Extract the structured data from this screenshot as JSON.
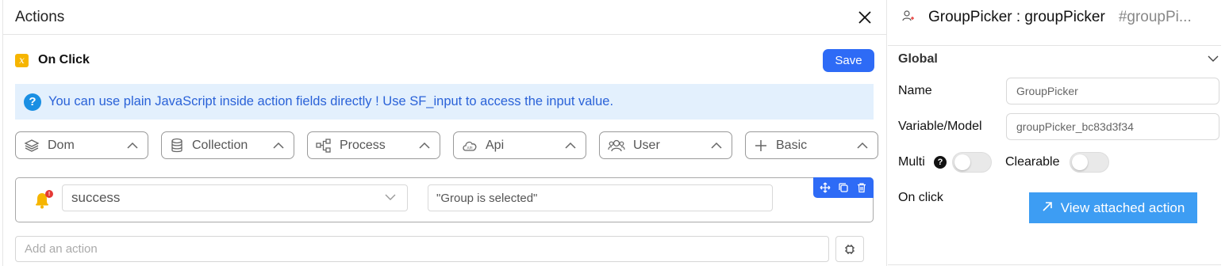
{
  "actions_panel": {
    "title": "Actions",
    "event": {
      "badge": "x",
      "label": "On Click"
    },
    "save_label": "Save",
    "info": {
      "icon": "?",
      "text": "You can use plain JavaScript inside action fields directly ! Use SF_input to access the input value."
    },
    "categories": [
      {
        "label": "Dom",
        "icon": "layers-icon"
      },
      {
        "label": "Collection",
        "icon": "database-icon"
      },
      {
        "label": "Process",
        "icon": "flow-icon"
      },
      {
        "label": "Api",
        "icon": "cloud-api-icon"
      },
      {
        "label": "User",
        "icon": "users-icon"
      },
      {
        "label": "Basic",
        "icon": "plus-icon"
      }
    ],
    "action": {
      "icon": "bell-icon",
      "badge": "!",
      "type_value": "success",
      "message_value": "\"Group is selected\""
    },
    "add_action_placeholder": "Add an action"
  },
  "props_panel": {
    "component_name": "GroupPicker : groupPicker",
    "component_id": "#groupPi...",
    "section_title": "Global",
    "name_label": "Name",
    "name_placeholder": "GroupPicker",
    "variable_label": "Variable/Model",
    "variable_placeholder": "groupPicker_bc83d3f34",
    "multi_label": "Multi",
    "multi_help": "?",
    "clearable_label": "Clearable",
    "onclick_label": "On click",
    "view_action_label": "View attached action",
    "colors": {
      "primary": "#2e6bf6",
      "info_bg": "#e3f0fd",
      "view_button": "#3d9df3"
    }
  }
}
